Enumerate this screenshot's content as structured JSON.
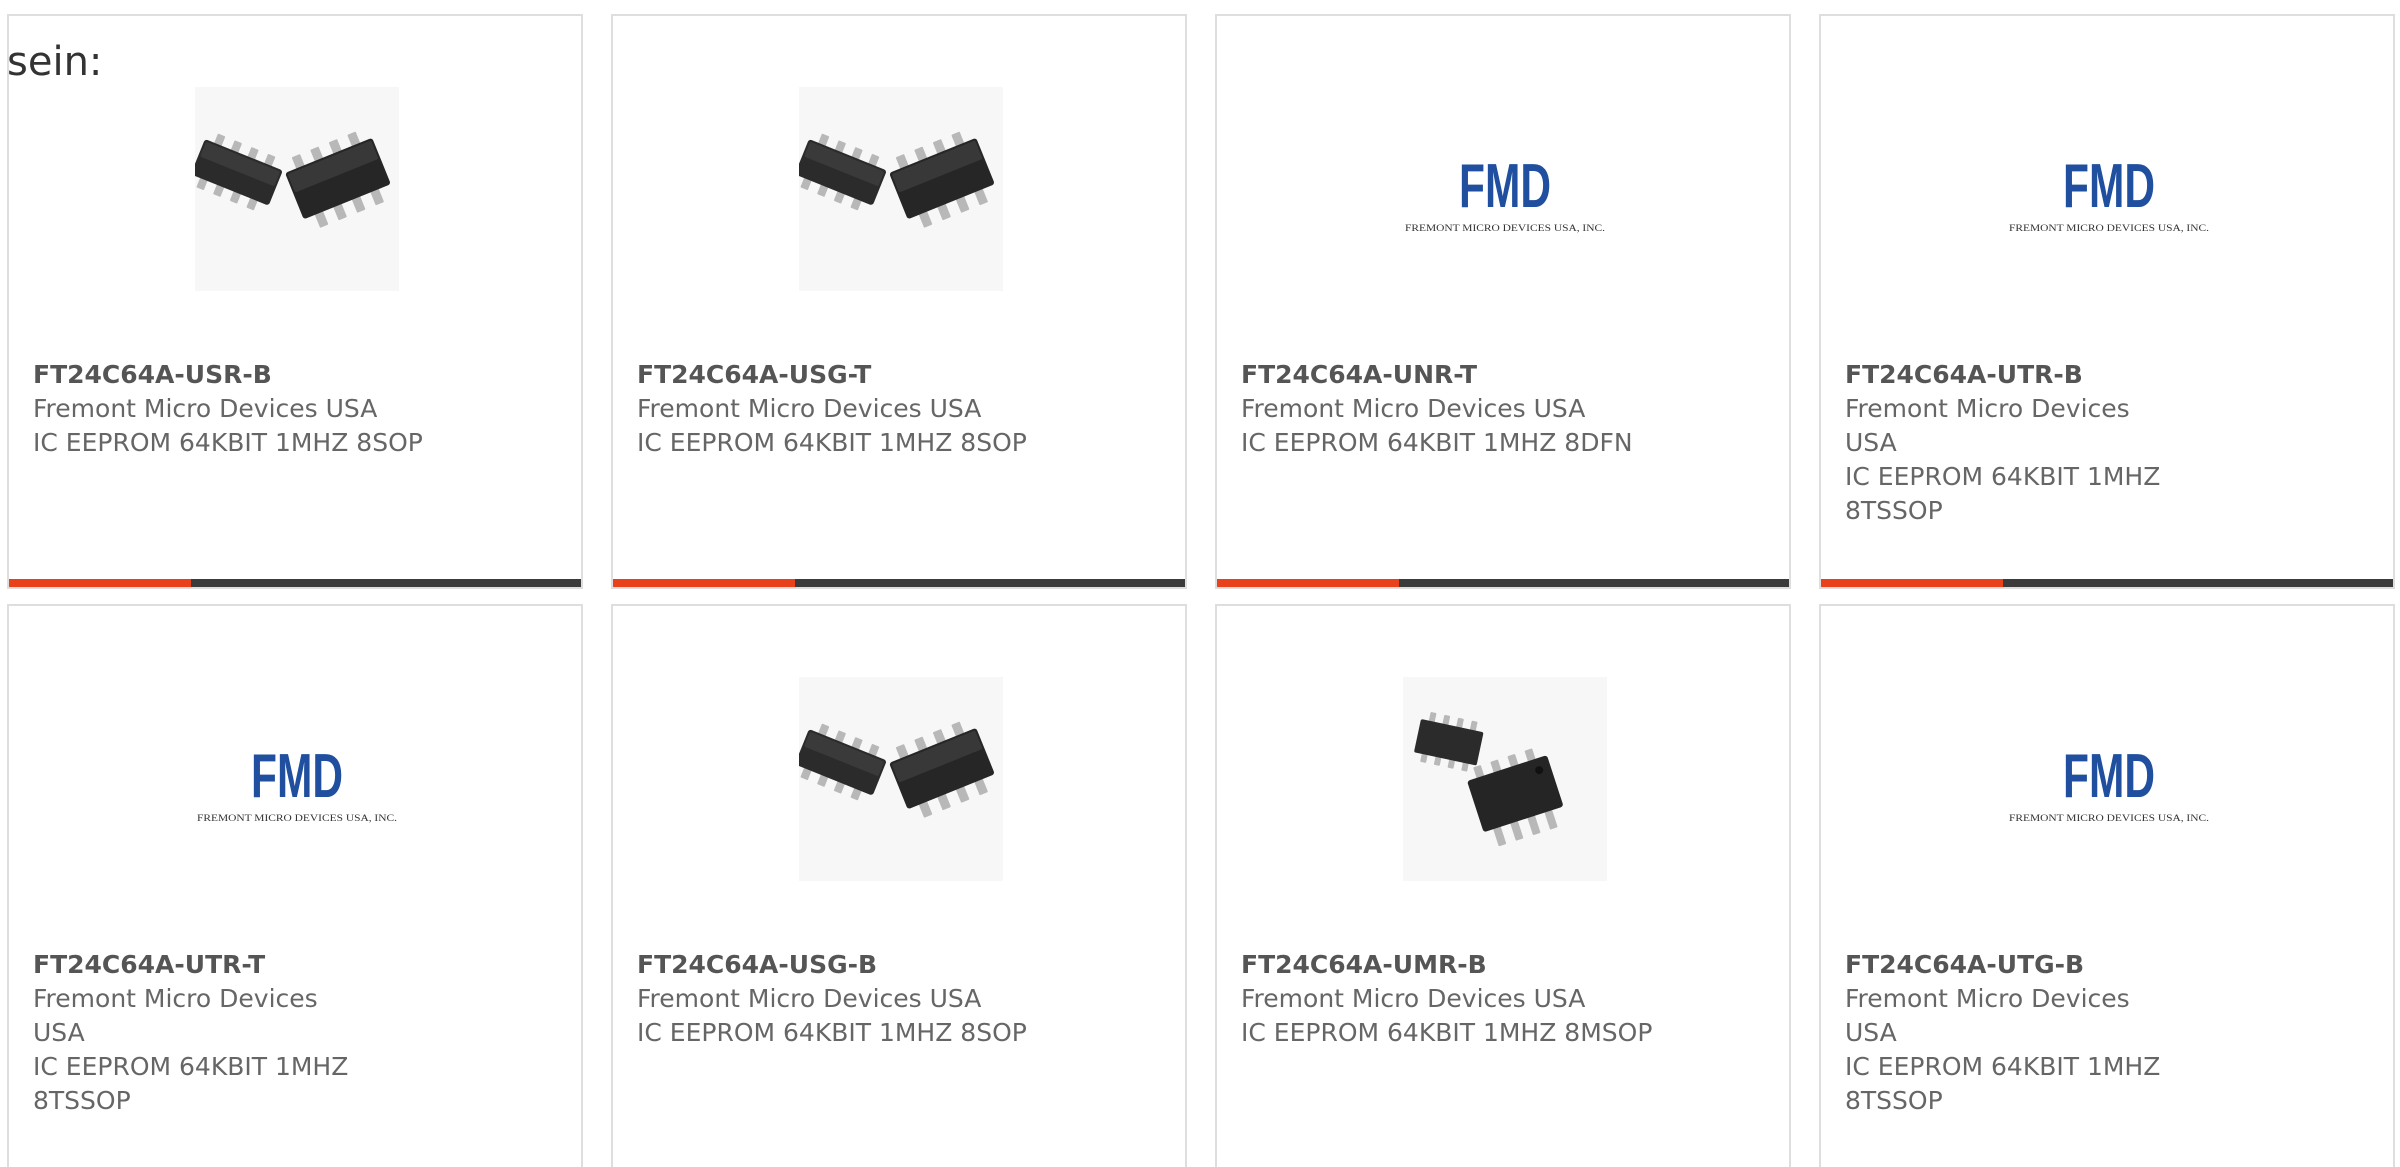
{
  "intro_text": "sein:",
  "colors": {
    "accent": "#e8421c",
    "bar": "#3b3b3b",
    "fmd_blue": "#1f4f9e",
    "card_border": "#dedede"
  },
  "products": [
    {
      "part_number": "FT24C64A-USR-B",
      "manufacturer": "Fremont Micro Devices USA",
      "description": "IC EEPROM 64KBIT 1MHZ 8SOP",
      "image": "sop8-chip-image"
    },
    {
      "part_number": "FT24C64A-USG-T",
      "manufacturer": "Fremont Micro Devices USA",
      "description": "IC EEPROM 64KBIT 1MHZ 8SOP",
      "image": "sop8-chip-image"
    },
    {
      "part_number": "FT24C64A-UNR-T",
      "manufacturer": "Fremont Micro Devices USA",
      "description": "IC EEPROM 64KBIT 1MHZ 8DFN",
      "image": "fmd-logo"
    },
    {
      "part_number": "FT24C64A-UTR-B",
      "manufacturer": "Fremont Micro Devices USA",
      "description": "IC EEPROM 64KBIT 1MHZ 8TSSOP",
      "image": "fmd-logo"
    },
    {
      "part_number": "FT24C64A-UTR-T",
      "manufacturer": "Fremont Micro Devices USA",
      "description": "IC EEPROM 64KBIT 1MHZ 8TSSOP",
      "image": "fmd-logo"
    },
    {
      "part_number": "FT24C64A-USG-B",
      "manufacturer": "Fremont Micro Devices USA",
      "description": "IC EEPROM 64KBIT 1MHZ 8SOP",
      "image": "sop8-chip-image"
    },
    {
      "part_number": "FT24C64A-UMR-B",
      "manufacturer": "Fremont Micro Devices USA",
      "description": "IC EEPROM 64KBIT 1MHZ 8MSOP",
      "image": "msop8-chip-image"
    },
    {
      "part_number": "FT24C64A-UTG-B",
      "manufacturer": "Fremont Micro Devices USA",
      "description": "IC EEPROM 64KBIT 1MHZ 8TSSOP",
      "image": "fmd-logo"
    }
  ],
  "fmd_logo": {
    "mark": "FMD",
    "tagline": "FREMONT MICRO DEVICES USA, INC."
  }
}
